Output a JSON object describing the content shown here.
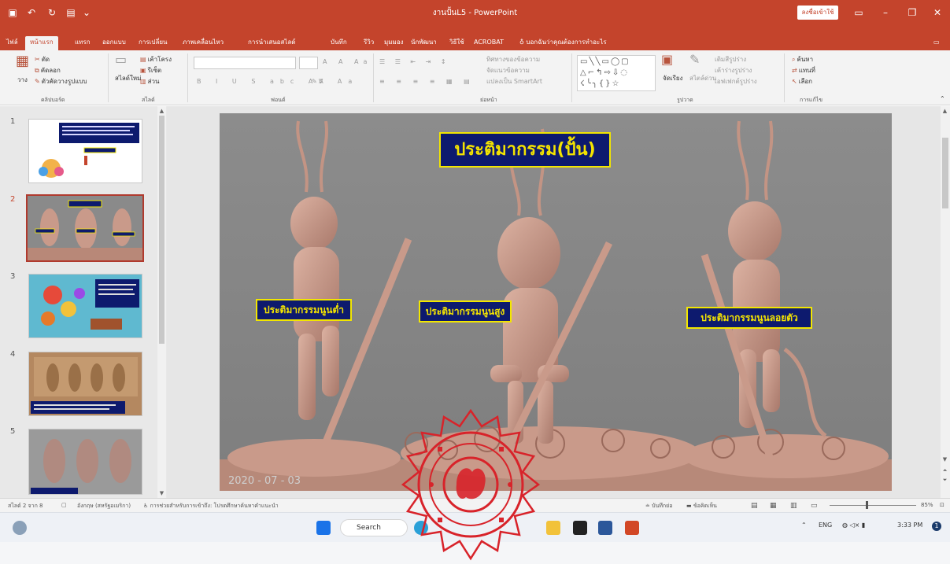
{
  "window": {
    "title": "งานปั้นL5  -  PowerPoint",
    "sign_in": "ลงชื่อเข้าใช้",
    "colors": {
      "accent": "#c4442c",
      "slide_box": "#0d1a6e",
      "slide_text": "#f4e400"
    }
  },
  "tabs": [
    {
      "label": "ไฟล์"
    },
    {
      "label": "หน้าแรก"
    },
    {
      "label": "แทรก"
    },
    {
      "label": "ออกแบบ"
    },
    {
      "label": "การเปลี่ยน"
    },
    {
      "label": "ภาพเคลื่อนไหว"
    },
    {
      "label": "การนำเสนอสไลด์"
    },
    {
      "label": "บันทึก"
    },
    {
      "label": "รีวิว"
    },
    {
      "label": "มุมมอง"
    },
    {
      "label": "นักพัฒนา"
    },
    {
      "label": "วิธีใช้"
    },
    {
      "label": "ACROBAT"
    }
  ],
  "tell_me": "บอกฉันว่าคุณต้องการทำอะไร",
  "ribbon": {
    "clipboard": {
      "paste": "วาง",
      "cut": "ตัด",
      "copy": "คัดลอก",
      "format_painter": "ตัวคัดวางรูปแบบ",
      "label": "คลิปบอร์ด"
    },
    "slides": {
      "new_slide": "สไลด์ใหม่",
      "layout": "เค้าโครง",
      "reset": "รีเซ็ต",
      "section": "ส่วน",
      "label": "สไลด์"
    },
    "font": {
      "label": "ฟอนต์"
    },
    "paragraph": {
      "text_direction": "ทิศทางของข้อความ",
      "align_text": "จัดแนวข้อความ",
      "smartart": "แปลงเป็น SmartArt",
      "label": "ย่อหน้า"
    },
    "drawing": {
      "arrange": "จัดเรียง",
      "quick_styles": "สไตล์ด่วน",
      "shape_fill": "เติมสีรูปร่าง",
      "shape_outline": "เค้าร่างรูปร่าง",
      "shape_effects": "เอฟเฟกต์รูปร่าง",
      "label": "รูปวาด"
    },
    "editing": {
      "find": "ค้นหา",
      "replace": "แทนที่",
      "select": "เลือก",
      "label": "การแก้ไข"
    }
  },
  "thumbnails": [
    {
      "number": "1"
    },
    {
      "number": "2"
    },
    {
      "number": "3"
    },
    {
      "number": "4"
    },
    {
      "number": "5"
    }
  ],
  "slide": {
    "title": "ประติมากรรม(ปั้น)",
    "labels": [
      "ประติมากรรมนูนต่ำ",
      "ประติมากรรมนูนสูง",
      "ประติมากรรมนูนลอยตัว"
    ],
    "watermark": "2020 - 07 - 03"
  },
  "status": {
    "slide_count": "สไลด์ 2 จาก 8",
    "language": "อังกฤษ (สหรัฐอเมริกา)",
    "accessibility": "การช่วยสำหรับการเข้าถึง: โปรดศึกษาค้นหาคำแนะนำ",
    "notes": "บันทึกย่อ",
    "comments": "ข้อคิดเห็น",
    "zoom": "85%"
  },
  "taskbar": {
    "search": "Search",
    "lang": "ENG",
    "time": "3:33 PM"
  }
}
